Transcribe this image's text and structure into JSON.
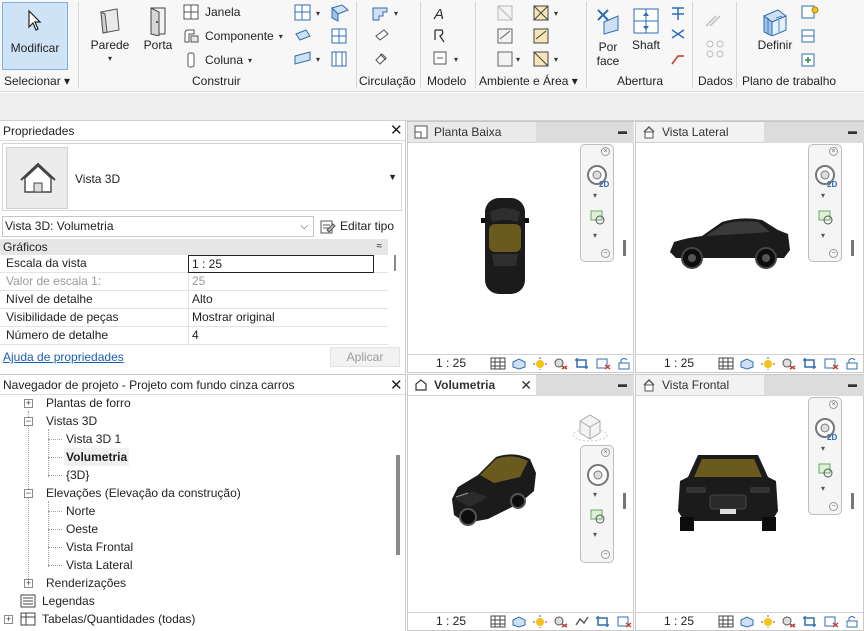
{
  "ribbon": {
    "modify": {
      "label": "Modificar"
    },
    "select_panel": {
      "label": "Selecionar ▾"
    },
    "build": {
      "label": "Construir",
      "wall": "Parede",
      "door": "Porta",
      "window": "Janela",
      "component": "Componente",
      "column": "Coluna"
    },
    "circulation": {
      "label": "Circulação"
    },
    "model": {
      "label": "Modelo"
    },
    "room_area": {
      "label": "Ambiente e Área ▾"
    },
    "opening": {
      "label": "Abertura",
      "by_face": "Por face",
      "shaft": "Shaft"
    },
    "datum": {
      "label": "Dados"
    },
    "work_plane": {
      "label": "Plano de trabalho",
      "set": "Definir"
    }
  },
  "properties": {
    "title": "Propriedades",
    "type_name": "Vista 3D",
    "view_selector": "Vista 3D: Volumetria",
    "edit_type": "Editar tipo",
    "group": "Gráficos",
    "rows": [
      {
        "key": "Escala da vista",
        "value": "1 : 25",
        "dim": false
      },
      {
        "key": "Valor de escala    1:",
        "value": "25",
        "dim": true
      },
      {
        "key": "Nível de detalhe",
        "value": "Alto",
        "dim": false
      },
      {
        "key": "Visibilidade de peças",
        "value": "Mostrar original",
        "dim": false
      },
      {
        "key": "Número de detalhe",
        "value": "4",
        "dim": false
      }
    ],
    "help_link": "Ajuda de propriedades",
    "apply": "Aplicar"
  },
  "browser": {
    "title": "Navegador de projeto - Projeto com fundo cinza carros",
    "items": {
      "ceiling_plans": "Plantas de forro",
      "views_3d": "Vistas 3D",
      "view_3d_1": "Vista 3D 1",
      "volumetria": "Volumetria",
      "default_3d": "{3D}",
      "elevations": "Elevações (Elevação da construção)",
      "north": "Norte",
      "west": "Oeste",
      "front": "Vista Frontal",
      "side": "Vista Lateral",
      "renderings": "Renderizações",
      "legends": "Legendas",
      "schedules": "Tabelas/Quantidades (todas)"
    }
  },
  "viewports": {
    "plan": {
      "title": "Planta Baixa",
      "scale": "1 : 25"
    },
    "side": {
      "title": "Vista Lateral",
      "scale": "1 : 25"
    },
    "volumetria": {
      "title": "Volumetria",
      "scale": "1 : 25"
    },
    "front": {
      "title": "Vista Frontal",
      "scale": "1 : 25"
    }
  },
  "colors": {
    "accent": "#1a5fb4",
    "selected_tool": "#cfe3f7",
    "car": "#1b1b1b",
    "roof": "#6b5a1e"
  }
}
